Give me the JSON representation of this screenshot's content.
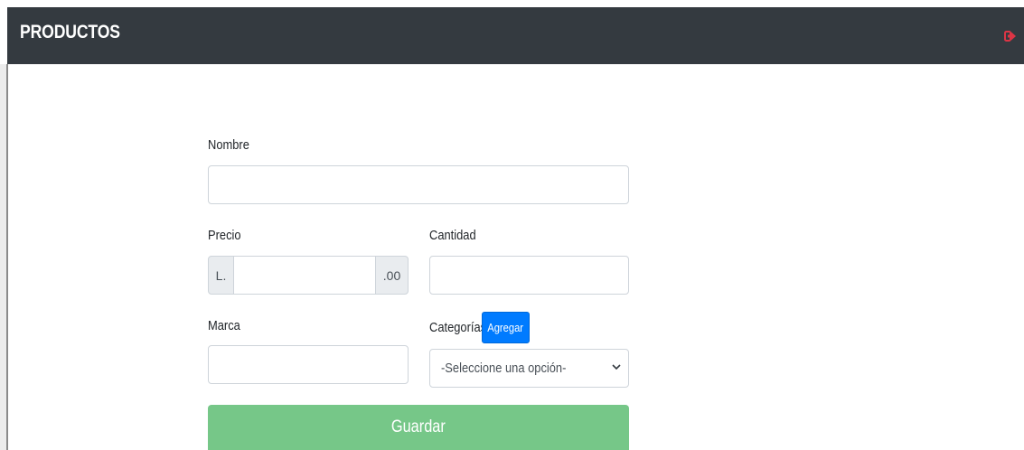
{
  "header": {
    "title": "PRODUCTOS",
    "logout_icon": "sign-out-icon",
    "logout_color": "#dc3545"
  },
  "form": {
    "nombre": {
      "label": "Nombre",
      "value": ""
    },
    "precio": {
      "label": "Precio",
      "prefix": "L.",
      "suffix": ".00",
      "value": ""
    },
    "cantidad": {
      "label": "Cantidad",
      "value": ""
    },
    "marca": {
      "label": "Marca",
      "value": ""
    },
    "categorias": {
      "label": "Categorías",
      "add_button": "Agregar",
      "selected": "-Seleccione una opción-",
      "chevron_icon": "chevron-down-icon"
    },
    "submit_label": "Guardar"
  },
  "colors": {
    "header_bg": "#343a40",
    "primary": "#007bff",
    "success_disabled": "#76c788"
  }
}
